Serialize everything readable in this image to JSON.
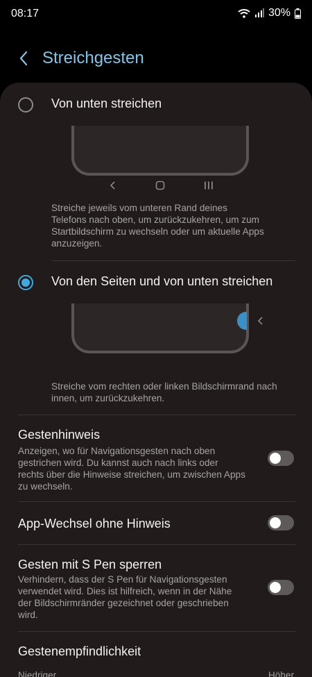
{
  "status_bar": {
    "time": "08:17",
    "battery": "30%",
    "icons": [
      "wifi-icon",
      "signal-icon",
      "battery-icon"
    ]
  },
  "header": {
    "title": "Streichgesten",
    "back_icon": "chevron-left-icon"
  },
  "options": [
    {
      "label": "Von unten streichen",
      "selected": false,
      "description": [
        "Streiche jeweils vom unteren Rand deines",
        "Telefons nach oben, um zurückzukehren, um zum",
        "Startbildschirm zu wechseln oder um aktuelle Apps",
        "anzuzeigen."
      ]
    },
    {
      "label": "Von den Seiten und von unten streichen",
      "selected": true,
      "description": [
        "Streiche vom rechten oder linken Bildschirmrand nach",
        "innen, um zurückzukehren."
      ]
    }
  ],
  "settings": [
    {
      "title": "Gestenhinweis",
      "description": [
        "Anzeigen, wo für Navigationsgesten nach oben",
        "gestrichen wird. Du kannst auch nach links oder",
        "rechts über die Hinweise streichen, um zwischen Apps",
        "zu wechseln."
      ],
      "enabled": false
    },
    {
      "title": "App-Wechsel ohne Hinweis",
      "enabled": false
    },
    {
      "title": "Gesten mit S Pen sperren",
      "description": [
        "Verhindern, dass der S Pen für Navigationsgesten",
        "verwendet wird. Dies ist hilfreich, wenn in der Nähe",
        "der Bildschirmränder gezeichnet oder geschrieben",
        "wird."
      ],
      "enabled": false
    },
    {
      "title": "Gestenempfindlichkeit",
      "slider_min_label": "Niedriger",
      "slider_max_label": "Höher"
    }
  ],
  "colors": {
    "accent": "#3fa9e0",
    "title": "#7fc6e8",
    "card_bg": "#211b1b"
  }
}
